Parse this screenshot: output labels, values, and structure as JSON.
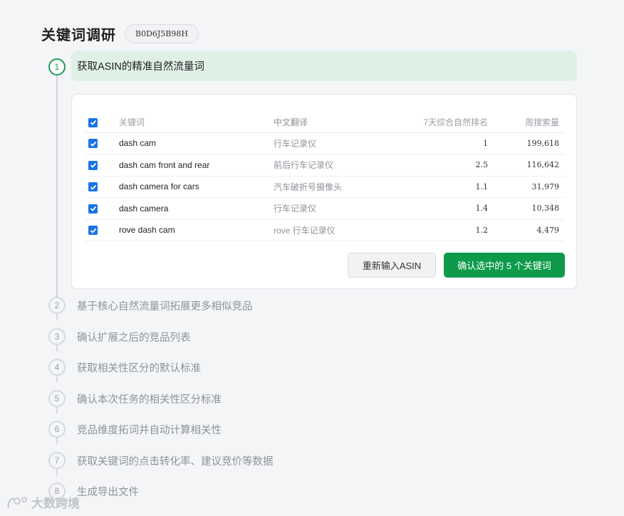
{
  "header": {
    "title": "关键词调研",
    "badge": "B0D6J5B98H"
  },
  "steps": [
    {
      "number": "1",
      "label": "获取ASIN的精准自然流量词"
    },
    {
      "number": "2",
      "label": "基于核心自然流量词拓展更多相似竞品"
    },
    {
      "number": "3",
      "label": "确认扩展之后的竞品列表"
    },
    {
      "number": "4",
      "label": "获取相关性区分的默认标准"
    },
    {
      "number": "5",
      "label": "确认本次任务的相关性区分标准"
    },
    {
      "number": "6",
      "label": "竞品维度拓词并自动计算相关性"
    },
    {
      "number": "7",
      "label": "获取关键词的点击转化率、建议竞价等数据"
    },
    {
      "number": "8",
      "label": "生成导出文件"
    }
  ],
  "table": {
    "headers": {
      "keyword": "关键词",
      "translation": "中文翻译",
      "rank": "7天综合自然排名",
      "volume": "周搜索量"
    },
    "rows": [
      {
        "checked": true,
        "keyword": "dash cam",
        "translation": "行车记录仪",
        "rank": "1",
        "volume": "199,618"
      },
      {
        "checked": true,
        "keyword": "dash cam front and rear",
        "translation": "前后行车记录仪",
        "rank": "2.5",
        "volume": "116,642"
      },
      {
        "checked": true,
        "keyword": "dash camera for cars",
        "translation": "汽车破折号摄像头",
        "rank": "1.1",
        "volume": "31,979"
      },
      {
        "checked": true,
        "keyword": "dash camera",
        "translation": "行车记录仪",
        "rank": "1.4",
        "volume": "10,348"
      },
      {
        "checked": true,
        "keyword": "rove dash cam",
        "translation": "rove 行车记录仪",
        "rank": "1.2",
        "volume": "4,479"
      }
    ]
  },
  "buttons": {
    "reset": "重新输入ASIN",
    "confirm": "确认选中的 5 个关键词"
  },
  "watermark": "大数跨境",
  "colors": {
    "accent_green": "#0d9b4b",
    "active_step_bg": "#dff0e7",
    "checkbox_blue": "#1a73e8"
  }
}
